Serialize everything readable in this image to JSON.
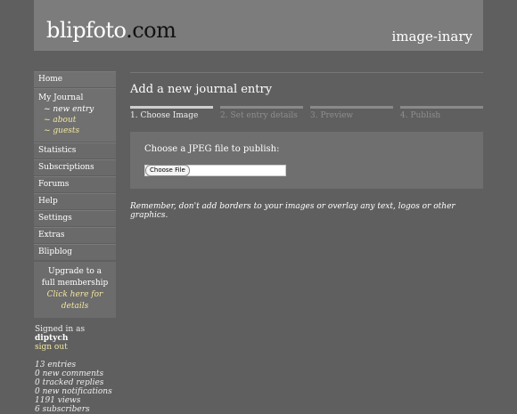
{
  "header": {
    "logo_main": "blipfoto",
    "logo_dot": ".",
    "logo_tld": "com",
    "journal_name": "image-inary"
  },
  "sidebar": {
    "home": "Home",
    "my_journal": "My Journal",
    "sub_items": [
      "~ new entry",
      "~ about",
      "~ guests"
    ],
    "items": [
      "Statistics",
      "Subscriptions",
      "Forums",
      "Help",
      "Settings",
      "Extras",
      "Blipblog"
    ],
    "upgrade_line1": "Upgrade to a",
    "upgrade_line2": "full membership",
    "upgrade_link": "Click here for details",
    "signed_in_label": "Signed in as",
    "username": "diptych",
    "sign_out": "sign out",
    "stats": [
      "13 entries",
      "0 new comments",
      "0 tracked replies",
      "0 new notifications",
      "1191 views",
      "6 subscribers"
    ]
  },
  "main": {
    "title": "Add a new journal entry",
    "steps": [
      "1. Choose Image",
      "2. Set entry details",
      "3. Preview",
      "4. Publish"
    ],
    "upload_label": "Choose a JPEG file to publish:",
    "choose_file_button": "Choose File",
    "reminder": "Remember, don't add borders to your images or overlay any text, logos or other graphics."
  }
}
